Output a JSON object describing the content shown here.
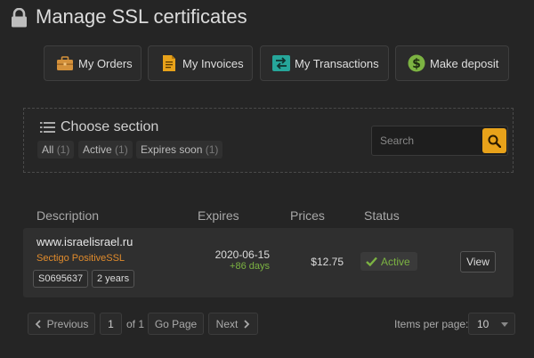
{
  "header": {
    "title": "Manage SSL certificates",
    "icon": "lock-icon"
  },
  "nav": [
    {
      "label": "My Orders",
      "icon": "briefcase-icon"
    },
    {
      "label": "My Invoices",
      "icon": "invoice-icon"
    },
    {
      "label": "My Transactions",
      "icon": "transactions-icon"
    },
    {
      "label": "Make deposit",
      "icon": "dollar-icon"
    }
  ],
  "section": {
    "title": "Choose section",
    "filters": [
      {
        "label": "All",
        "count": "(1)"
      },
      {
        "label": "Active",
        "count": "(1)"
      },
      {
        "label": "Expires soon",
        "count": "(1)"
      }
    ],
    "search_placeholder": "Search"
  },
  "table": {
    "headers": [
      "Description",
      "Expires",
      "Prices",
      "Status"
    ],
    "rows": [
      {
        "domain": "www.israelisrael.ru",
        "product": "Sectigo PositiveSSL",
        "order_id": "S0695637",
        "period": "2 years",
        "expires_date": "2020-06-15",
        "expires_days": "+86 days",
        "price": "$12.75",
        "status": "Active",
        "action": "View"
      }
    ]
  },
  "pagination": {
    "previous": "Previous",
    "page": "1",
    "of": "of 1",
    "go": "Go Page",
    "next": "Next",
    "items_per_page_label": "Items per page:",
    "items_per_page_value": "10"
  },
  "colors": {
    "accent": "#e8a21a",
    "active": "#7cb342",
    "product": "#e08b2c"
  }
}
